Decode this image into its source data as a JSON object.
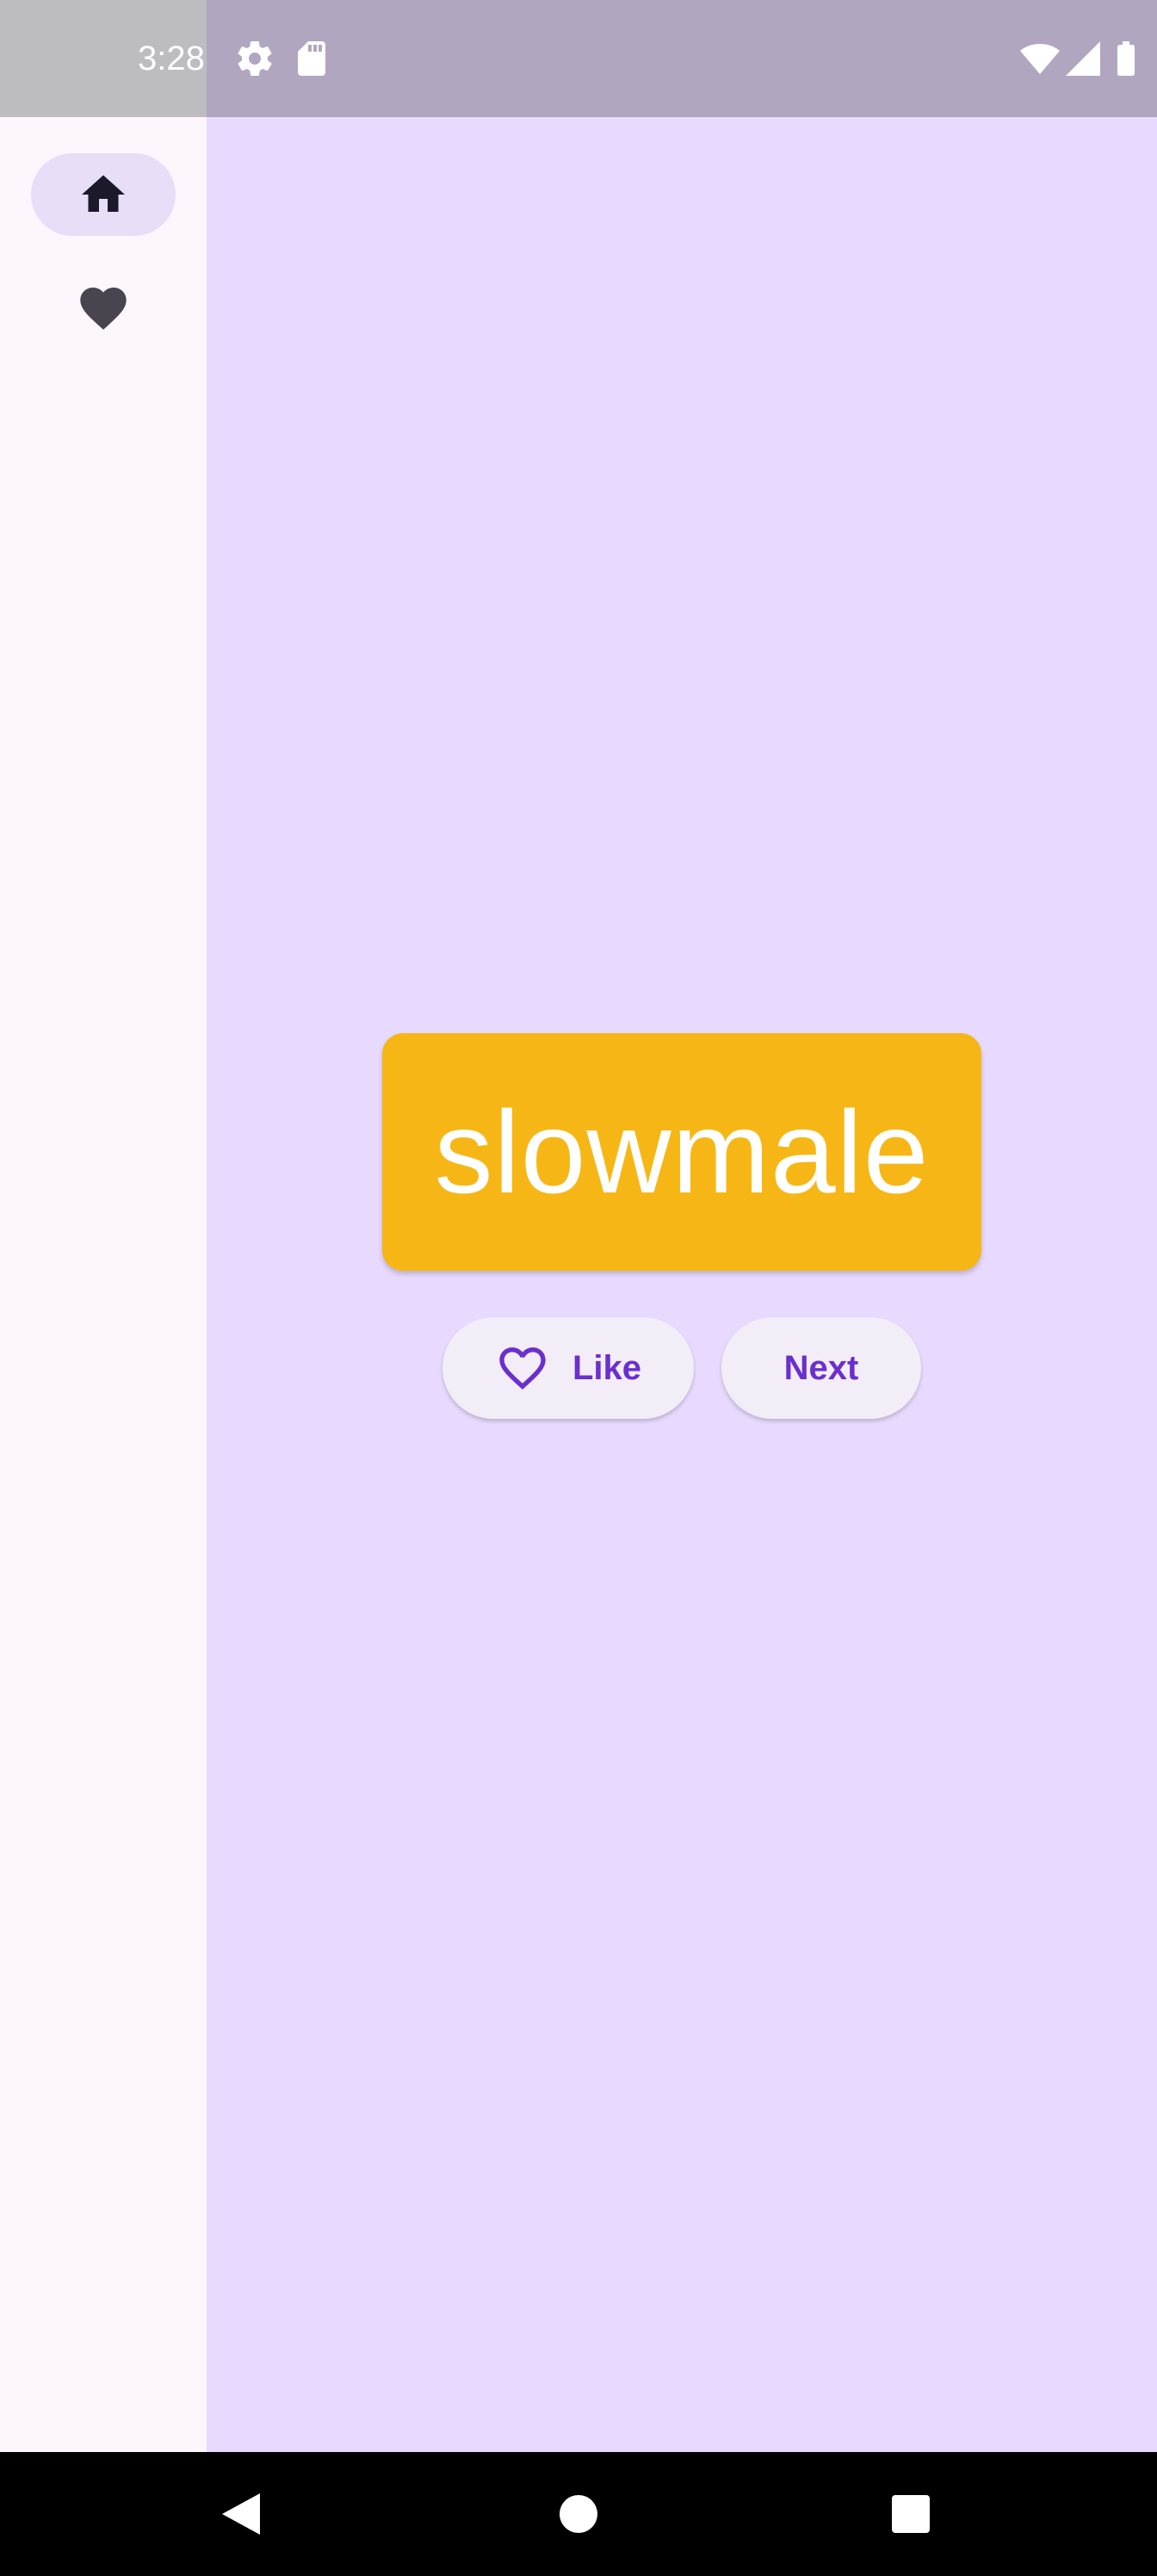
{
  "status_bar": {
    "time": "3:28",
    "icons": [
      "settings-icon",
      "sd-card-icon",
      "wifi-icon",
      "signal-icon",
      "battery-icon"
    ]
  },
  "nav_rail": {
    "items": [
      {
        "icon": "home-icon",
        "active": true
      },
      {
        "icon": "heart-icon",
        "active": false
      }
    ]
  },
  "main": {
    "word": "slowmale",
    "like_label": "Like",
    "next_label": "Next"
  },
  "system_nav": {
    "buttons": [
      "back-icon",
      "home-circle-icon",
      "recents-icon"
    ]
  },
  "colors": {
    "background": "#e8daff",
    "card": "#f6b716",
    "accent": "#6b2fcf",
    "button_bg": "#f3edf7",
    "rail_bg": "#fdf7fd",
    "active_indicator": "#e8def8"
  }
}
